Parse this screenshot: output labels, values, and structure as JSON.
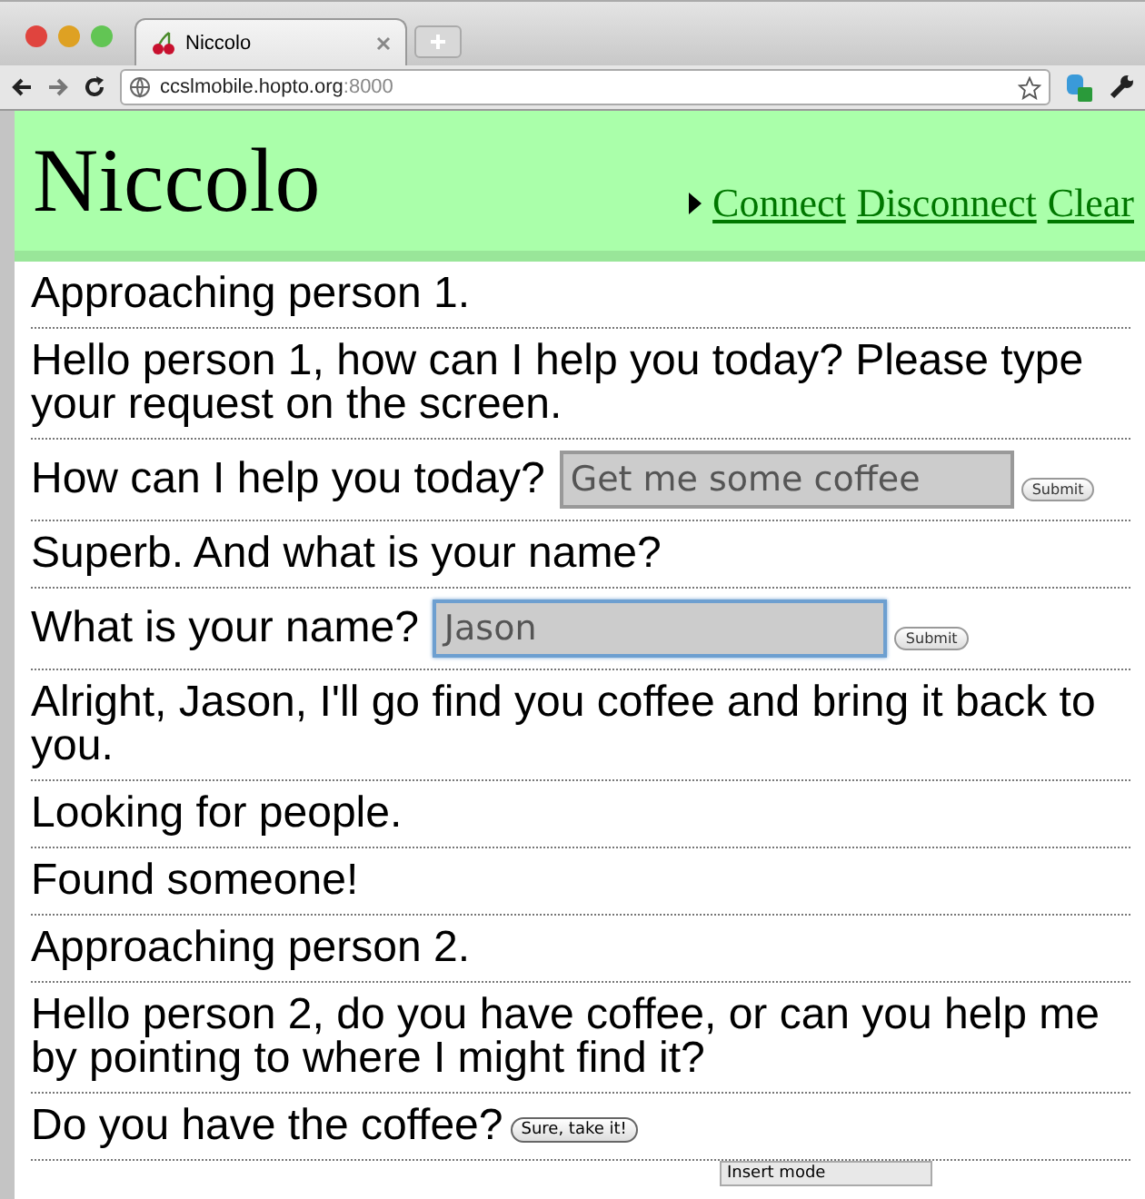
{
  "browser": {
    "tab_title": "Niccolo",
    "url_host": "ccslmobile.hopto.org",
    "url_port": ":8000"
  },
  "header": {
    "title": "Niccolo",
    "links": [
      "Connect",
      "Disconnect",
      "Clear"
    ]
  },
  "messages": [
    {
      "kind": "text",
      "text": "Approaching person 1."
    },
    {
      "kind": "text",
      "text": "Hello person 1, how can I help you today? Please type your request on the screen."
    },
    {
      "kind": "input",
      "label": "How can I help you today?",
      "value": "Get me some coffee",
      "focused": false,
      "button": "Submit"
    },
    {
      "kind": "text",
      "text": "Superb. And what is your name?"
    },
    {
      "kind": "input",
      "label": "What is your name?",
      "value": "Jason",
      "focused": true,
      "button": "Submit"
    },
    {
      "kind": "text",
      "text": "Alright, Jason, I'll go find you coffee and bring it back to you."
    },
    {
      "kind": "text",
      "text": "Looking for people."
    },
    {
      "kind": "text",
      "text": "Found someone!"
    },
    {
      "kind": "text",
      "text": "Approaching person 2."
    },
    {
      "kind": "text",
      "text": "Hello person 2, do you have coffee, or can you help me by pointing to where I might find it?"
    },
    {
      "kind": "button",
      "label": "Do you have the coffee?",
      "button": "Sure, take it!"
    }
  ],
  "status": "Insert mode"
}
